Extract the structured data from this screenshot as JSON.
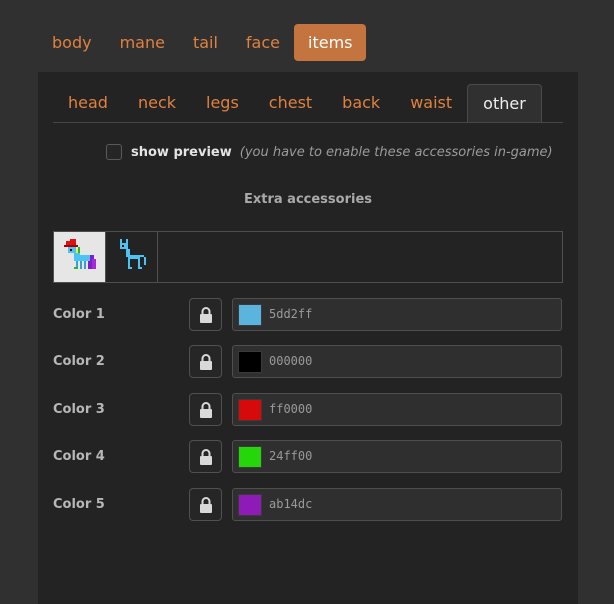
{
  "top_tabs": [
    {
      "label": "body",
      "active": false
    },
    {
      "label": "mane",
      "active": false
    },
    {
      "label": "tail",
      "active": false
    },
    {
      "label": "face",
      "active": false
    },
    {
      "label": "items",
      "active": true
    }
  ],
  "sub_tabs": [
    {
      "label": "head"
    },
    {
      "label": "neck"
    },
    {
      "label": "legs"
    },
    {
      "label": "chest"
    },
    {
      "label": "back"
    },
    {
      "label": "waist"
    },
    {
      "label": "other"
    }
  ],
  "preview": {
    "label": "show preview",
    "note": "(you have to enable these accessories in-game)",
    "checked": false
  },
  "section_title": "Extra accessories",
  "accessories": [
    {
      "icon": "pony-with-hat-icon",
      "selected": true
    },
    {
      "icon": "pony-skeleton-icon",
      "selected": false
    }
  ],
  "colors": [
    {
      "label": "Color 1",
      "value": "5dd2ff",
      "swatch": "#5ab4de"
    },
    {
      "label": "Color 2",
      "value": "000000",
      "swatch": "#000000"
    },
    {
      "label": "Color 3",
      "value": "ff0000",
      "swatch": "#d60a0a"
    },
    {
      "label": "Color 4",
      "value": "24ff00",
      "swatch": "#24d60a"
    },
    {
      "label": "Color 5",
      "value": "ab14dc",
      "swatch": "#8e1ab8"
    }
  ]
}
